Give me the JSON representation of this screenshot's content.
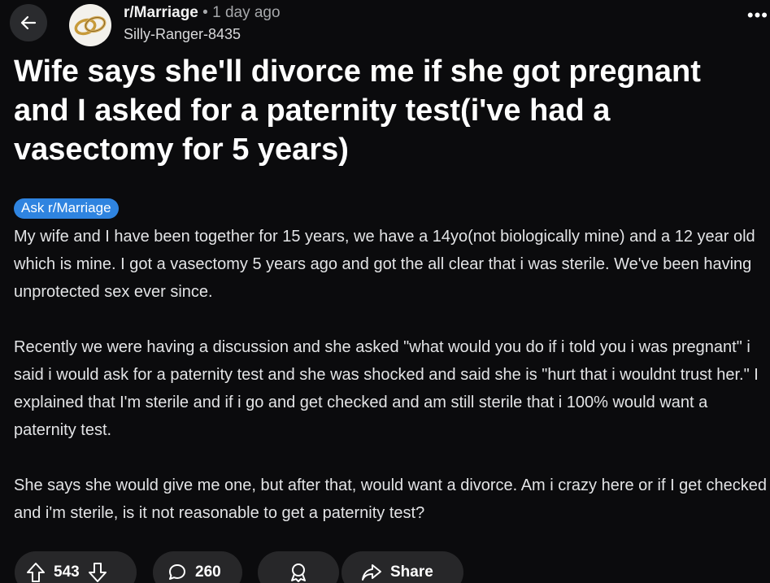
{
  "header": {
    "subreddit": "r/Marriage",
    "separator": "•",
    "time_ago": "1 day ago",
    "author": "Silly-Ranger-8435",
    "more_label": "•••"
  },
  "post": {
    "title": "Wife says she'll divorce me if she got pregnant and I asked for a paternity test(i've had a vasectomy for 5 years)",
    "flair": "Ask r/Marriage",
    "flair_color": "#2f84e0",
    "paragraphs": [
      "My wife and I have been together for 15 years, we have a 14yo(not biologically mine) and a 12 year old which is mine. I got a vasectomy 5 years ago and got the all clear that i was sterile. We've been having unprotected sex ever since.",
      "Recently we were having a discussion and she asked \"what would you do if i told you i was pregnant\" i said i would ask for a paternity test and she was shocked and said she is \"hurt that i wouldnt trust her.\" I explained that I'm sterile and if i go and get checked and am still sterile that i 100% would want a paternity test.",
      "She says she would give me one, but after that, would want a divorce. Am i crazy here or if I get checked and i'm sterile, is it not reasonable to get a paternity test?"
    ]
  },
  "actions": {
    "votes": "543",
    "comments": "260",
    "share_label": "Share"
  },
  "icons": {
    "back": "back-arrow-icon",
    "upvote": "upvote-icon",
    "downvote": "downvote-icon",
    "comment": "comment-icon",
    "award": "award-icon",
    "share": "share-icon"
  }
}
